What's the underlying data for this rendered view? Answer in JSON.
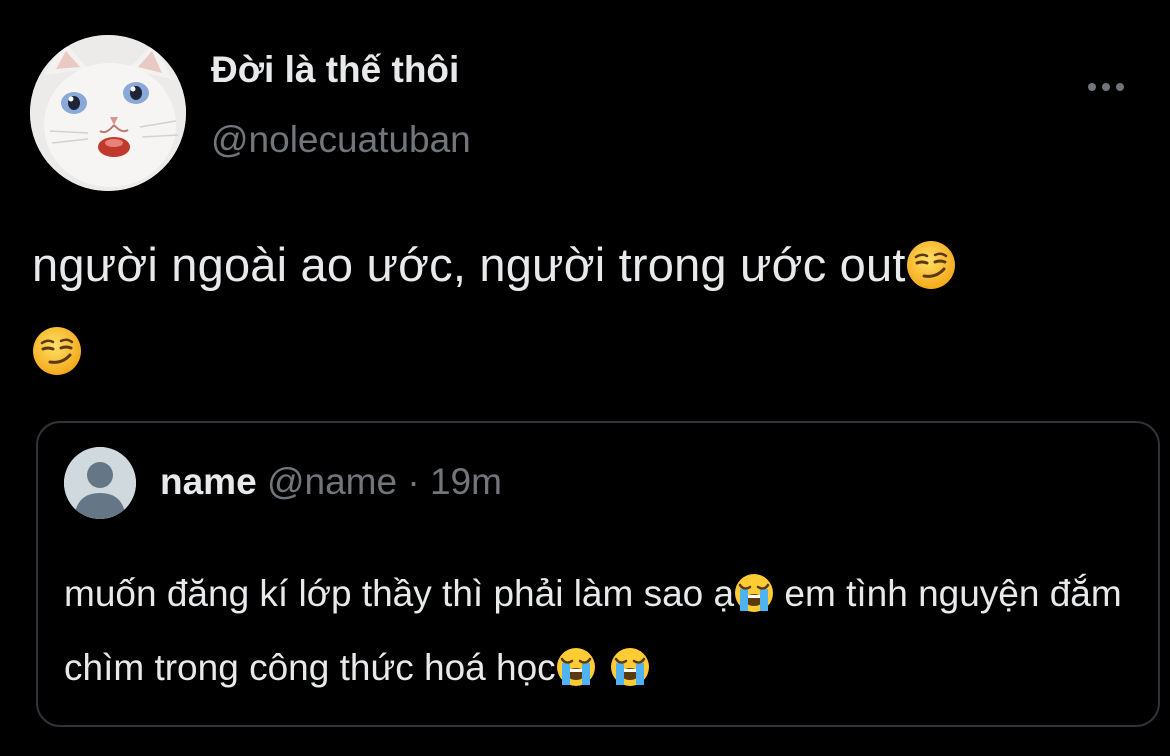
{
  "tweet": {
    "display_name": "Đời là thế thôi",
    "handle": "@nolecuatuban",
    "text": "người ngoài ao ước, người trong ước out",
    "emojis": [
      "smirking-face",
      "smirking-face"
    ]
  },
  "quoted_tweet": {
    "name": "name",
    "handle": "@name",
    "separator": "·",
    "time": "19m",
    "text_part1": "muốn đăng kí lớp thầy thì phải làm sao ạ",
    "text_part2": " em tình nguyện đắm chìm trong công thức hoá học",
    "emojis": [
      "loudly-crying-face",
      "loudly-crying-face",
      "loudly-crying-face"
    ]
  },
  "colors": {
    "background": "#000000",
    "primary_text": "#e7e9ea",
    "secondary_text": "#71767b",
    "border": "#2f3336"
  }
}
